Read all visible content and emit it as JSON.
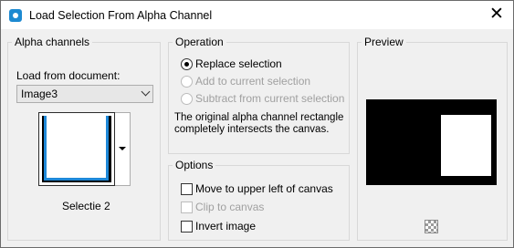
{
  "window": {
    "title": "Load Selection From Alpha Channel",
    "icon": "load-selection-icon",
    "close_glyph": "✕"
  },
  "alpha_channels": {
    "title": "Alpha channels",
    "load_from_label": "Load from document:",
    "document_value": "Image3",
    "channel_name": "Selectie 2"
  },
  "operation": {
    "title": "Operation",
    "options": [
      {
        "label": "Replace selection",
        "selected": true,
        "enabled": true
      },
      {
        "label": "Add to current selection",
        "selected": false,
        "enabled": false
      },
      {
        "label": "Subtract from current selection",
        "selected": false,
        "enabled": false
      }
    ],
    "info_text": "The original alpha channel rectangle completely intersects the canvas."
  },
  "options": {
    "title": "Options",
    "items": [
      {
        "label": "Move to upper left of canvas",
        "checked": false,
        "enabled": true
      },
      {
        "label": "Clip to canvas",
        "checked": false,
        "enabled": false
      },
      {
        "label": "Invert image",
        "checked": false,
        "enabled": true
      }
    ]
  },
  "preview": {
    "title": "Preview",
    "checker_icon": "transparency-checker-icon"
  }
}
